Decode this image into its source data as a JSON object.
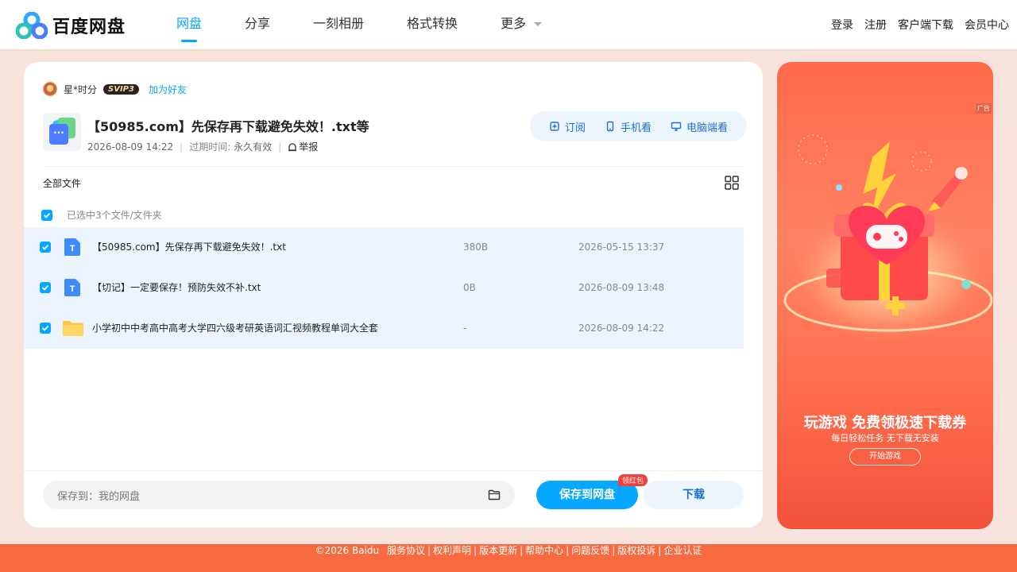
{
  "header": {
    "logo_text": "百度网盘",
    "nav": [
      {
        "label": "网盘",
        "active": true
      },
      {
        "label": "分享",
        "active": false
      },
      {
        "label": "一刻相册",
        "active": false
      },
      {
        "label": "格式转换",
        "active": false
      },
      {
        "label": "更多",
        "active": false
      }
    ],
    "links": [
      "登录",
      "注册",
      "客户端下载",
      "会员中心"
    ]
  },
  "share": {
    "owner_name": "星*时分",
    "owner_badge": "SVIP3",
    "add_friend": "加为好友",
    "title": "【50985.com】先保存再下载避免失效！.txt等",
    "created": "2026-08-09 14:22",
    "expire_label": "过期时间:",
    "expire_value": "永久有效",
    "report": "举报",
    "actions": {
      "subscribe": "订阅",
      "mobile": "手机看",
      "desktop": "电脑端看"
    }
  },
  "filelist": {
    "breadcrumb": "全部文件",
    "selected_text": "已选中3个文件/文件夹",
    "files": [
      {
        "name": "【50985.com】先保存再下载避免失效！.txt",
        "size": "380B",
        "date": "2026-05-15 13:37",
        "type": "txt",
        "checked": true
      },
      {
        "name": "【切记】一定要保存！预防失效不补.txt",
        "size": "0B",
        "date": "2026-08-09 13:48",
        "type": "txt",
        "checked": true
      },
      {
        "name": "小学初中中考高中高考大学四六级考研英语词汇视频教程单词大全套",
        "size": "-",
        "date": "2026-08-09 14:22",
        "type": "folder",
        "checked": true
      }
    ]
  },
  "bottom": {
    "save_to_label": "保存到：",
    "save_to_value": "我的网盘",
    "save_button": "保存到网盘",
    "save_badge": "领红包",
    "download_button": "下载"
  },
  "ad": {
    "label": "广告",
    "title": "玩游戏 免费领极速下载券",
    "subtitle": "每日轻松任务 无下载无安装",
    "button": "开始游戏"
  },
  "footer": {
    "copyright": "©2026 Baidu",
    "links": [
      "服务协议",
      "权利声明",
      "版本更新",
      "帮助中心",
      "问题反馈",
      "版权投诉",
      "企业认证"
    ]
  },
  "colors": {
    "accent": "#06a7ff",
    "row_selected": "#ecf5fd",
    "footer": "#f86a40",
    "page_bg": "#f7e3dc"
  }
}
